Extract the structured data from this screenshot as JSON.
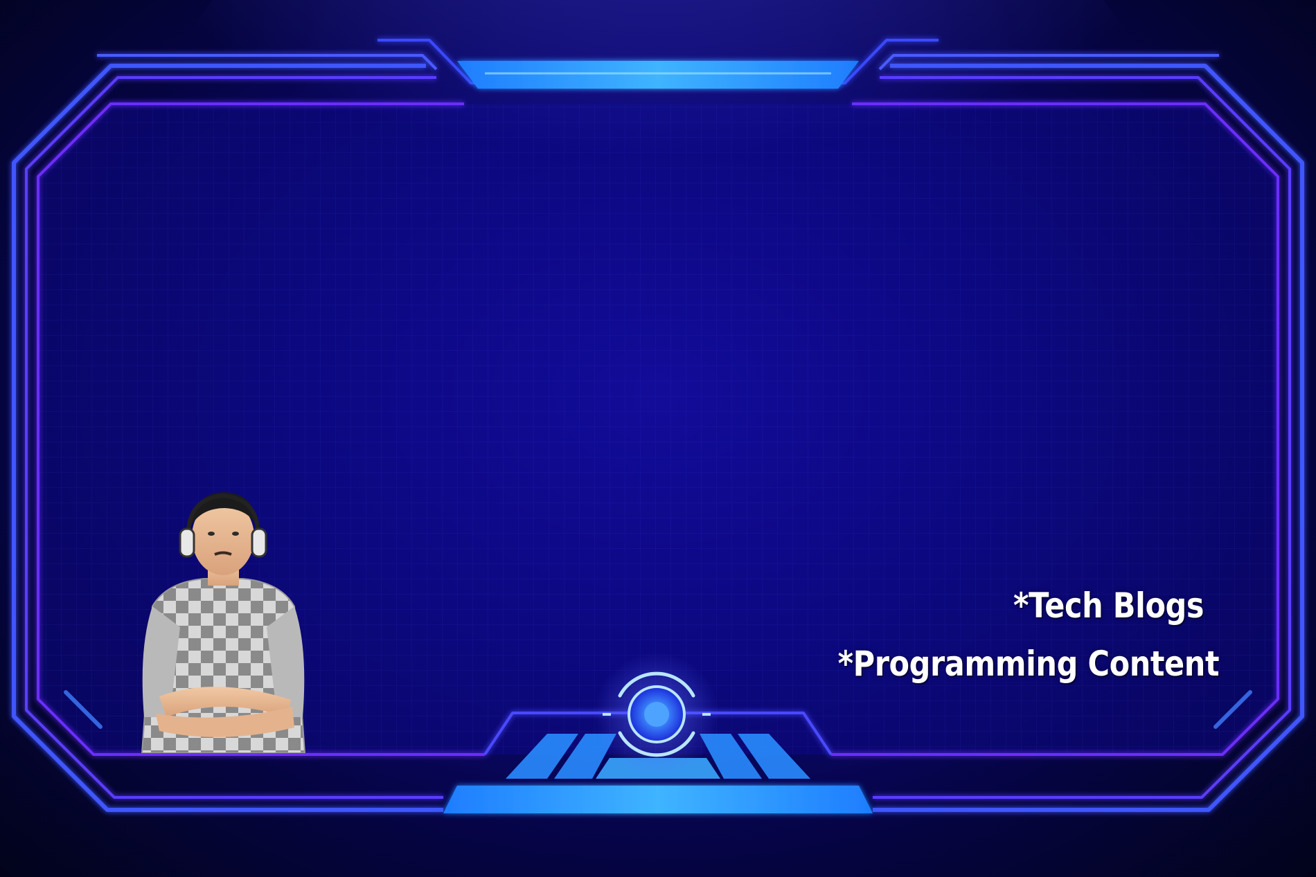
{
  "colors": {
    "background": "#03061e",
    "panel": "#0c0878",
    "frame_outer": "#3b4bff",
    "frame_inner": "#6a2cff",
    "accent_cyan": "#29a8ff",
    "text": "#ffffff"
  },
  "taglines": {
    "line1": "*Tech Blogs",
    "line2": "*Programming Content"
  },
  "graphics": {
    "frame": "sci-fi-hud-frame",
    "center_emblem": "glowing-circle-emblem",
    "portrait": "person-with-headphones-arms-crossed"
  }
}
